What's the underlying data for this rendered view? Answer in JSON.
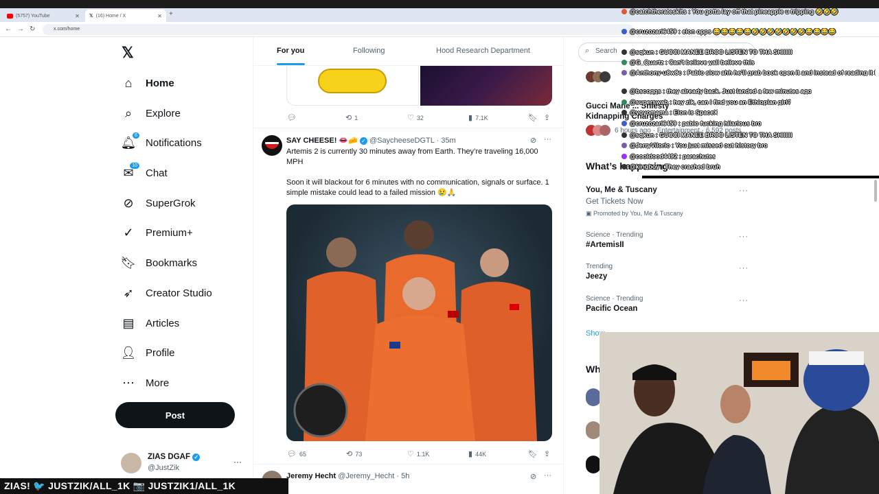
{
  "browser": {
    "tabs": [
      {
        "title": "(5757) YouTube",
        "icon": "youtube-icon"
      },
      {
        "title": "(16) Home / X",
        "icon": "x-icon"
      }
    ],
    "url": "x.com/home"
  },
  "sidebar": {
    "items": [
      {
        "label": "Home",
        "icon": "home-icon"
      },
      {
        "label": "Explore",
        "icon": "search-icon"
      },
      {
        "label": "Notifications",
        "icon": "bell-icon",
        "badge": "6"
      },
      {
        "label": "Chat",
        "icon": "chat-icon",
        "badge": "10"
      },
      {
        "label": "SuperGrok",
        "icon": "grok-icon"
      },
      {
        "label": "Premium+",
        "icon": "premium-icon"
      },
      {
        "label": "Bookmarks",
        "icon": "bookmark-icon"
      },
      {
        "label": "Creator Studio",
        "icon": "rocket-icon"
      },
      {
        "label": "Articles",
        "icon": "article-icon"
      },
      {
        "label": "Profile",
        "icon": "person-icon"
      },
      {
        "label": "More",
        "icon": "more-icon"
      }
    ],
    "post_label": "Post",
    "account": {
      "name": "ZIAS DGAF",
      "handle": "@JustZik"
    }
  },
  "feed": {
    "tabs": [
      "For you",
      "Following",
      "Hood Research Department"
    ],
    "prev_post": {
      "replies": "",
      "reposts": "1",
      "likes": "32",
      "views": "7.1K"
    },
    "post": {
      "name": "SAY CHEESE! 👄🧀",
      "handle": "@SaycheeseDGTL",
      "time": "· 35m",
      "text1": "Artemis 2 is currently 30 minutes away from Earth. They’re traveling 16,000 MPH",
      "text2": "Soon it will blackout for 6 minutes with no communication, signals or surface. 1 simple mistake could lead to a failed mission 😢🙏",
      "replies": "65",
      "reposts": "73",
      "likes": "1.1K",
      "views": "44K"
    },
    "next_post": {
      "name": "Jeremy Hecht",
      "handle": "@Jeremy_Hecht",
      "time": "· 5h"
    }
  },
  "right": {
    "search_placeholder": "Search",
    "partial_trend": "Gucci Mane ... Shiesty Kidnapping Charges",
    "partial_meta": "6 hours ago · Entertainment · 6,592 posts",
    "whats_happening": "What’s happening",
    "promo": {
      "title": "You, Me & Tuscany",
      "subtitle": "Get Tickets Now",
      "meta": "Promoted by You, Me & Tuscany"
    },
    "trends": [
      {
        "category": "Science · Trending",
        "name": "#ArtemisII"
      },
      {
        "category": "Trending",
        "name": "Jeezy"
      },
      {
        "category": "Science · Trending",
        "name": "Pacific Ocean"
      }
    ],
    "show_more": "Show",
    "who_to_follow": "Wh"
  },
  "chat": [
    {
      "user": "@catchtherateskits",
      "msg": "You gotta lay off that pineapple u tripping 🤣🤣🤣",
      "color": "#e4572e"
    },
    {
      "user": "@cruzozari6459",
      "msg": "elon opps 😂😂😂😂😂🤣🤣🤣🤣🤣🤣🤣😂😂😂😂",
      "color": "#3a5fcd"
    },
    {
      "user": "@sqkun",
      "msg": "GUCCI MANEE BROO LISTEN TO THA SHIIIIII",
      "color": "#333333"
    },
    {
      "user": "@G_Quartz",
      "msg": "Can't believe yall believe this",
      "color": "#2e8b57"
    },
    {
      "user": "@Anthony-u8w8c",
      "msg": "Pablo slow ahh he'll grab book open it and instead of reading it he just funna look at it",
      "color": "#7b5ea7"
    },
    {
      "user": "@bscoggs",
      "msg": "they already back. Just landed a few minutes ago",
      "color": "#333333"
    },
    {
      "user": "@superswab",
      "msg": "hey zik, can i find you an Ethiopian girl?",
      "color": "#2e8b57"
    },
    {
      "user": "@yoyomama",
      "msg": "Elon is SpaceX",
      "color": "#333333"
    },
    {
      "user": "@cruzozari6459",
      "msg": "pablo fucking hilarious bro",
      "color": "#3a5fcd"
    },
    {
      "user": "@sqkun",
      "msg": "GUCCI MANEE BROO LISTEN TO THA SHIIIIII",
      "color": "#333333"
    },
    {
      "user": "@JerryVilorio",
      "msg": "You just missed out history bro",
      "color": "#7b5ea7"
    },
    {
      "user": "@cooldood4492",
      "msg": "parachutes",
      "color": "#9b30ff"
    },
    {
      "user": "@kingboy",
      "msg": "They crashed bruh",
      "color": "#333333"
    }
  ],
  "banner": "ZIAS! 🐦 JUSTZIK/ALL_1K 📷 JUSTZIK1/ALL_1K",
  "colors": {
    "accent": "#1d9bf0",
    "text": "#0f1419",
    "muted": "#536471"
  }
}
